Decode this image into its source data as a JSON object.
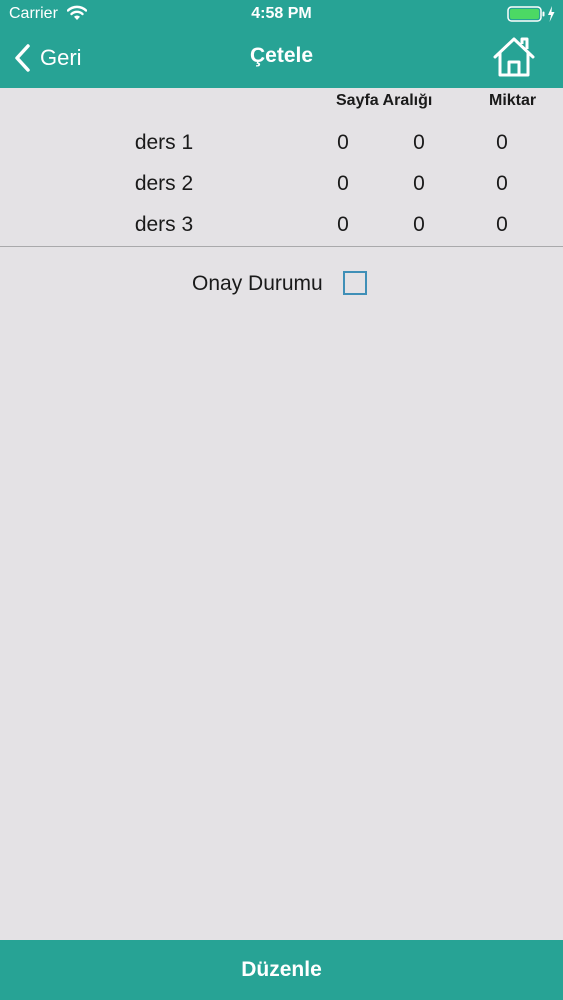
{
  "status_bar": {
    "carrier": "Carrier",
    "time": "4:58 PM",
    "wifi_icon": "wifi-icon",
    "battery_icon": "battery-charging-icon"
  },
  "nav": {
    "back_label": "Geri",
    "title": "Çetele",
    "home_icon": "home-icon"
  },
  "table": {
    "headers": [
      "Sayfa Aralığı",
      "Miktar"
    ],
    "rows": [
      {
        "label": "ders 1",
        "values": [
          "0",
          "0",
          "0"
        ]
      },
      {
        "label": "ders 2",
        "values": [
          "0",
          "0",
          "0"
        ]
      },
      {
        "label": "ders 3",
        "values": [
          "0",
          "0",
          "0"
        ]
      }
    ]
  },
  "approval": {
    "label": "Onay Durumu",
    "checked": false
  },
  "footer": {
    "button_label": "Düzenle"
  },
  "colors": {
    "accent": "#27a395",
    "background": "#e4e2e5",
    "checkbox_border": "#3f8fb7"
  }
}
